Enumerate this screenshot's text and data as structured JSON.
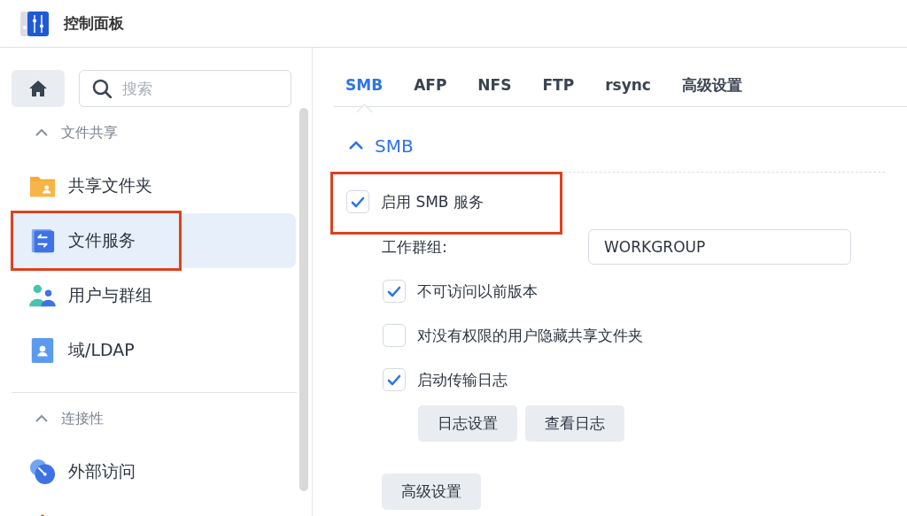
{
  "window": {
    "title": "控制面板"
  },
  "sidebar": {
    "search": {
      "placeholder": "搜索"
    },
    "sections": [
      {
        "title": "文件共享",
        "expanded": true,
        "items": [
          {
            "label": "共享文件夹",
            "kind": "folder",
            "selected": false,
            "highlighted": false
          },
          {
            "label": "文件服务",
            "kind": "file-service",
            "selected": true,
            "highlighted": true
          },
          {
            "label": "用户与群组",
            "kind": "users",
            "selected": false,
            "highlighted": false
          },
          {
            "label": "域/LDAP",
            "kind": "domain",
            "selected": false,
            "highlighted": false
          }
        ]
      },
      {
        "title": "连接性",
        "expanded": true,
        "items": [
          {
            "label": "外部访问",
            "kind": "external",
            "selected": false,
            "highlighted": false
          },
          {
            "kind": "network",
            "selected": false,
            "highlighted": false
          }
        ]
      }
    ]
  },
  "tabs": [
    {
      "label": "SMB",
      "selected": true
    },
    {
      "label": "AFP",
      "selected": false
    },
    {
      "label": "NFS",
      "selected": false
    },
    {
      "label": "FTP",
      "selected": false
    },
    {
      "label": "rsync",
      "selected": false
    },
    {
      "label": "高级设置",
      "selected": false
    }
  ],
  "panel": {
    "title": "SMB",
    "expanded": true,
    "enable": {
      "label": "启用 SMB 服务",
      "checked": true,
      "highlighted": true
    },
    "workgroup": {
      "label": "工作群组:",
      "value": "WORKGROUP"
    },
    "options": [
      {
        "label": "不可访问以前版本",
        "checked": true
      },
      {
        "label": "对没有权限的用户隐藏共享文件夹",
        "checked": false
      },
      {
        "label": "启动传输日志",
        "checked": true
      }
    ],
    "log_buttons": [
      "日志设置",
      "查看日志"
    ],
    "advanced_button": "高级设置"
  }
}
